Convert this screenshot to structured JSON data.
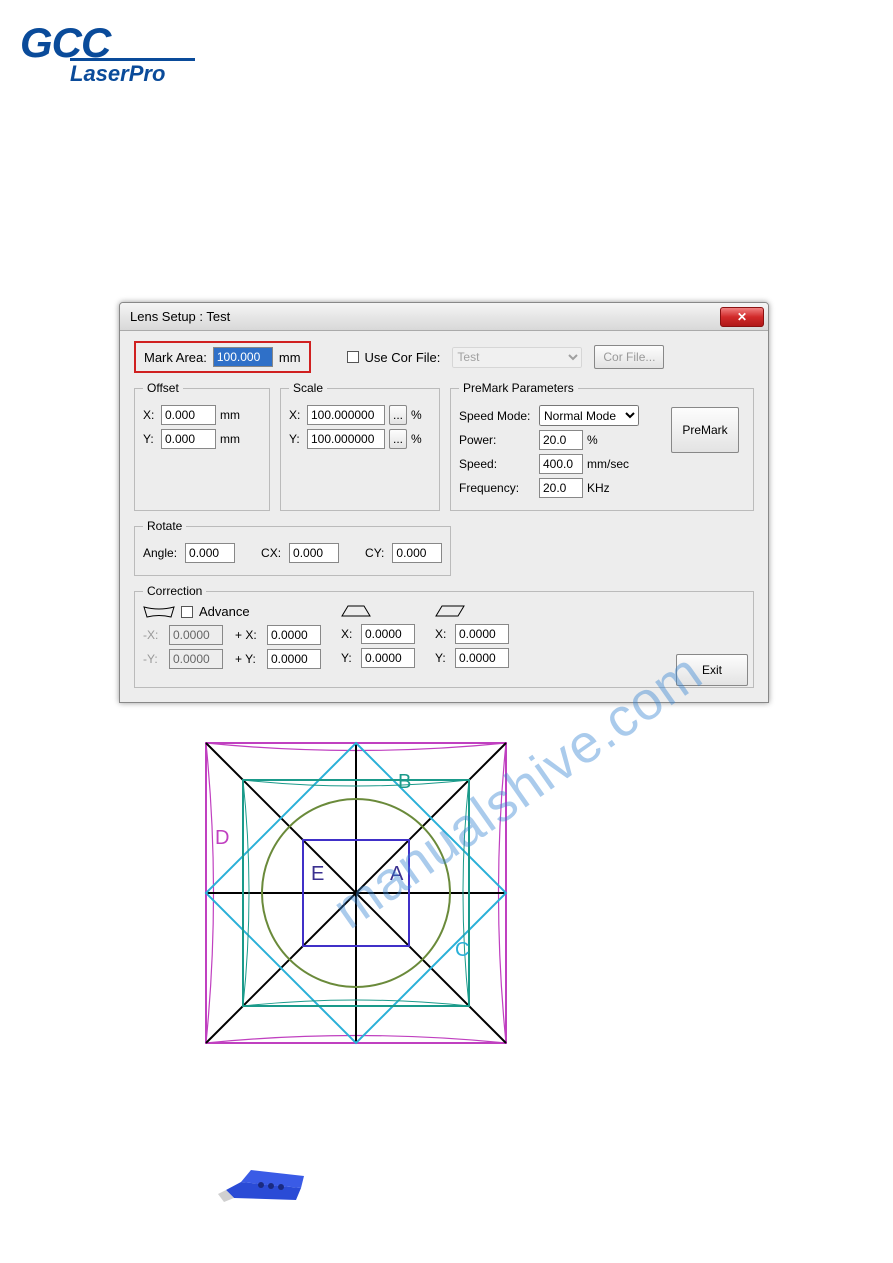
{
  "logo": {
    "main": "GCC",
    "sub": "LaserPro"
  },
  "dialog": {
    "title": "Lens Setup : Test",
    "close": "✕",
    "mark_area": {
      "label": "Mark Area:",
      "value": "100.000",
      "unit": "mm"
    },
    "use_cor": {
      "label": "Use Cor File:",
      "file": "Test",
      "button": "Cor File..."
    },
    "offset": {
      "legend": "Offset",
      "x_label": "X:",
      "x_value": "0.000",
      "x_unit": "mm",
      "y_label": "Y:",
      "y_value": "0.000",
      "y_unit": "mm"
    },
    "scale": {
      "legend": "Scale",
      "x_label": "X:",
      "x_value": "100.000000",
      "x_unit": "%",
      "y_label": "Y:",
      "y_value": "100.000000",
      "y_unit": "%",
      "dots": "..."
    },
    "rotate": {
      "legend": "Rotate",
      "angle_label": "Angle:",
      "angle_value": "0.000",
      "cx_label": "CX:",
      "cx_value": "0.000",
      "cy_label": "CY:",
      "cy_value": "0.000"
    },
    "premark": {
      "legend": "PreMark Parameters",
      "speedmode_label": "Speed Mode:",
      "speedmode_value": "Normal Mode",
      "power_label": "Power:",
      "power_value": "20.0",
      "power_unit": "%",
      "speed_label": "Speed:",
      "speed_value": "400.0",
      "speed_unit": "mm/sec",
      "freq_label": "Frequency:",
      "freq_value": "20.0",
      "freq_unit": "KHz",
      "button": "PreMark"
    },
    "correction": {
      "legend": "Correction",
      "advance_label": "Advance",
      "col1": {
        "mx_label": "-X:",
        "mx_value": "0.0000",
        "my_label": "-Y:",
        "my_value": "0.0000",
        "px_label": "+ X:",
        "px_value": "0.0000",
        "py_label": "+ Y:",
        "py_value": "0.0000"
      },
      "col2": {
        "x_label": "X:",
        "x_value": "0.0000",
        "y_label": "Y:",
        "y_value": "0.0000"
      },
      "col3": {
        "x_label": "X:",
        "x_value": "0.0000",
        "y_label": "Y:",
        "y_value": "0.0000"
      }
    },
    "exit": "Exit"
  },
  "geom": {
    "labels": {
      "a": "A",
      "b": "B",
      "c": "C",
      "d": "D",
      "e": "E"
    }
  },
  "watermark": "manualshive.com"
}
